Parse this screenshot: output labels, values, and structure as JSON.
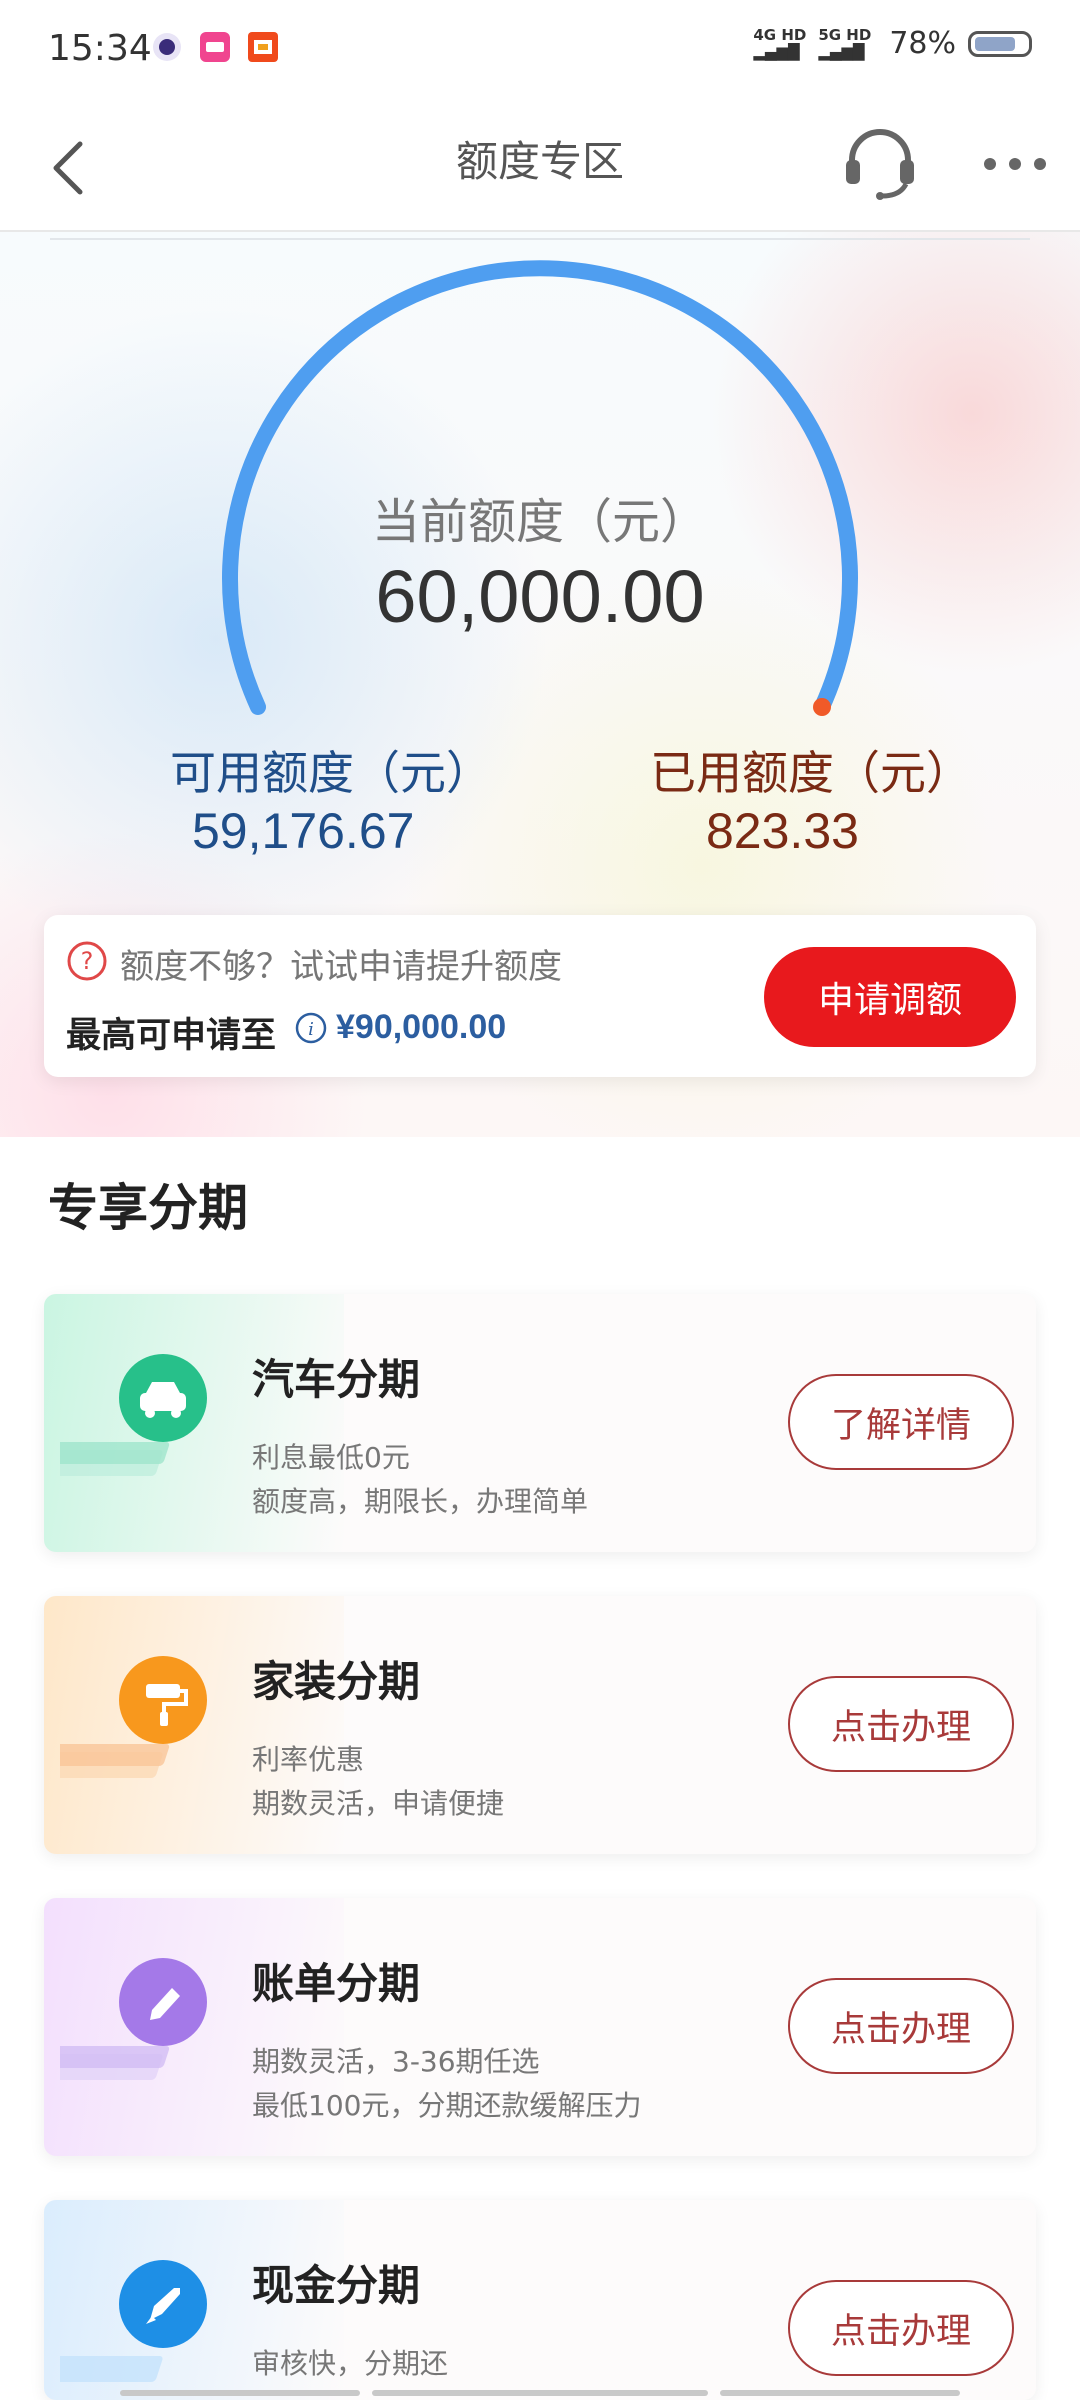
{
  "status_bar": {
    "time": "15:34",
    "network_4g": "4G HD",
    "network_5g": "5G HD",
    "battery": "78%",
    "battery_level": 0.78,
    "app_icons": [
      "moon-app-icon",
      "pink-app-icon",
      "store-app-icon"
    ]
  },
  "navbar": {
    "title": "额度专区",
    "back_icon": "chevron-left-icon",
    "service_icon": "headset-icon",
    "more_icon": "more-dots-icon"
  },
  "credit": {
    "current_label": "当前额度（元）",
    "current_value": "60,000.00",
    "available_label": "可用额度（元）",
    "available_value": "59,176.67",
    "used_label": "已用额度（元）",
    "used_value": "823.33",
    "used_fraction": 0.0137,
    "gauge_color": "#4f9ef0",
    "used_dot_color": "#f05a28"
  },
  "promo": {
    "question_text": "额度不够？试试申请提升额度",
    "max_label": "最高可申请至",
    "max_amount": "¥90,000.00",
    "apply_button": "申请调额",
    "button_color": "#e8191d"
  },
  "section": {
    "title": "专享分期"
  },
  "products": [
    {
      "title": "汽车分期",
      "line1": "利息最低0元",
      "line2": "额度高，期限长，办理简单",
      "button": "了解详情",
      "icon": "car-icon",
      "color": "#2cc28a"
    },
    {
      "title": "家装分期",
      "line1": "利率优惠",
      "line2": "期数灵活，申请便捷",
      "button": "点击办理",
      "icon": "paint-roller-icon",
      "color": "#f8981d"
    },
    {
      "title": "账单分期",
      "line1": "期数灵活，3-36期任选",
      "line2": "最低100元，分期还款缓解压力",
      "button": "点击办理",
      "icon": "pencil-icon",
      "color": "#a479e8"
    },
    {
      "title": "现金分期",
      "line1": "审核快，分期还",
      "line2": "",
      "button": "点击办理",
      "icon": "rocket-icon",
      "color": "#1e8fe6"
    }
  ]
}
